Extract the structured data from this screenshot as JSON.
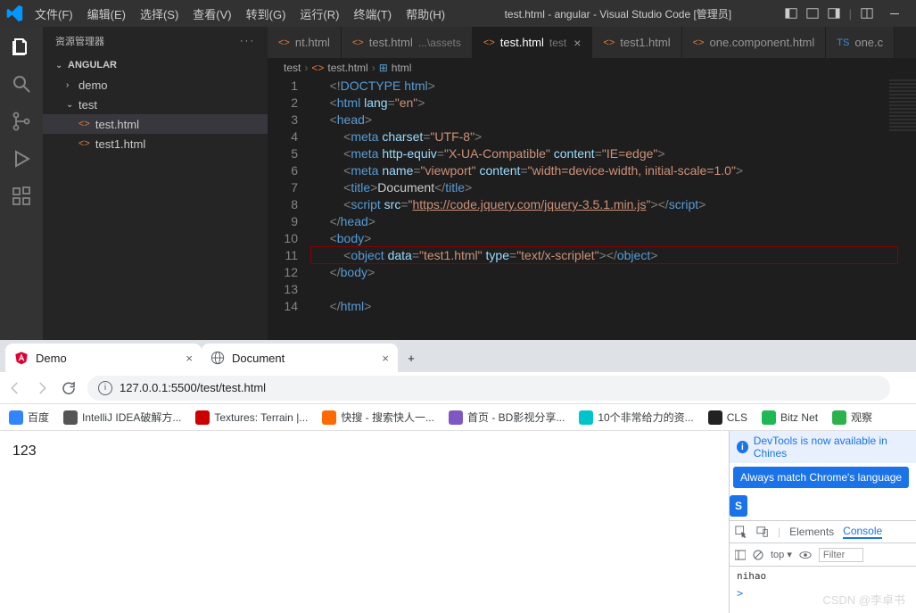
{
  "titlebar": {
    "menus": [
      "文件(F)",
      "编辑(E)",
      "选择(S)",
      "查看(V)",
      "转到(G)",
      "运行(R)",
      "终端(T)",
      "帮助(H)"
    ],
    "title": "test.html - angular - Visual Studio Code [管理员]"
  },
  "sidebar": {
    "title": "资源管理器",
    "root": "ANGULAR",
    "items": [
      {
        "label": "demo",
        "type": "folder",
        "expanded": false,
        "indent": 1
      },
      {
        "label": "test",
        "type": "folder",
        "expanded": true,
        "indent": 1
      },
      {
        "label": "test.html",
        "type": "file",
        "indent": 2,
        "active": true
      },
      {
        "label": "test1.html",
        "type": "file",
        "indent": 2
      }
    ]
  },
  "tabs": [
    {
      "label": "nt.html",
      "icon": "html",
      "partial": true
    },
    {
      "label": "test.html",
      "suffix": "...\\assets",
      "icon": "html"
    },
    {
      "label": "test.html",
      "suffix": "test",
      "icon": "html",
      "active": true,
      "close": true
    },
    {
      "label": "test1.html",
      "icon": "html"
    },
    {
      "label": "one.component.html",
      "icon": "html"
    },
    {
      "label": "one.c",
      "icon": "ts",
      "partial": true
    }
  ],
  "breadcrumbs": [
    "test",
    "test.html",
    "html"
  ],
  "code_lines": [
    {
      "n": 1,
      "segs": [
        [
          "    ",
          "p"
        ],
        [
          "<!",
          "punc"
        ],
        [
          "DOCTYPE html",
          "doc"
        ],
        [
          ">",
          "punc"
        ]
      ]
    },
    {
      "n": 2,
      "segs": [
        [
          "    ",
          "p"
        ],
        [
          "<",
          "punc"
        ],
        [
          "html ",
          "tag"
        ],
        [
          "lang",
          "attr"
        ],
        [
          "=",
          "punc"
        ],
        [
          "\"en\"",
          "str"
        ],
        [
          ">",
          "punc"
        ]
      ]
    },
    {
      "n": 3,
      "segs": [
        [
          "    ",
          "p"
        ],
        [
          "<",
          "punc"
        ],
        [
          "head",
          "tag"
        ],
        [
          ">",
          "punc"
        ]
      ]
    },
    {
      "n": 4,
      "segs": [
        [
          "        ",
          "p"
        ],
        [
          "<",
          "punc"
        ],
        [
          "meta ",
          "tag"
        ],
        [
          "charset",
          "attr"
        ],
        [
          "=",
          "punc"
        ],
        [
          "\"UTF-8\"",
          "str"
        ],
        [
          ">",
          "punc"
        ]
      ]
    },
    {
      "n": 5,
      "segs": [
        [
          "        ",
          "p"
        ],
        [
          "<",
          "punc"
        ],
        [
          "meta ",
          "tag"
        ],
        [
          "http-equiv",
          "attr"
        ],
        [
          "=",
          "punc"
        ],
        [
          "\"X-UA-Compatible\"",
          "str"
        ],
        [
          " ",
          "p"
        ],
        [
          "content",
          "attr"
        ],
        [
          "=",
          "punc"
        ],
        [
          "\"IE=edge\"",
          "str"
        ],
        [
          ">",
          "punc"
        ]
      ]
    },
    {
      "n": 6,
      "segs": [
        [
          "        ",
          "p"
        ],
        [
          "<",
          "punc"
        ],
        [
          "meta ",
          "tag"
        ],
        [
          "name",
          "attr"
        ],
        [
          "=",
          "punc"
        ],
        [
          "\"viewport\"",
          "str"
        ],
        [
          " ",
          "p"
        ],
        [
          "content",
          "attr"
        ],
        [
          "=",
          "punc"
        ],
        [
          "\"width=device-width, initial-scale=1.0\"",
          "str"
        ],
        [
          ">",
          "punc"
        ]
      ]
    },
    {
      "n": 7,
      "segs": [
        [
          "        ",
          "p"
        ],
        [
          "<",
          "punc"
        ],
        [
          "title",
          "tag"
        ],
        [
          ">",
          "punc"
        ],
        [
          "Document",
          "p"
        ],
        [
          "</",
          "punc"
        ],
        [
          "title",
          "tag"
        ],
        [
          ">",
          "punc"
        ]
      ]
    },
    {
      "n": 8,
      "segs": [
        [
          "        ",
          "p"
        ],
        [
          "<",
          "punc"
        ],
        [
          "script ",
          "tag"
        ],
        [
          "src",
          "attr"
        ],
        [
          "=",
          "punc"
        ],
        [
          "\"",
          "str"
        ],
        [
          "https://code.jquery.com/jquery-3.5.1.min.js",
          "url"
        ],
        [
          "\"",
          "str"
        ],
        [
          "></",
          "punc"
        ],
        [
          "script",
          "tag"
        ],
        [
          ">",
          "punc"
        ]
      ]
    },
    {
      "n": 9,
      "segs": [
        [
          "    ",
          "p"
        ],
        [
          "</",
          "punc"
        ],
        [
          "head",
          "tag"
        ],
        [
          ">",
          "punc"
        ]
      ]
    },
    {
      "n": 10,
      "segs": [
        [
          "    ",
          "p"
        ],
        [
          "<",
          "punc"
        ],
        [
          "body",
          "tag"
        ],
        [
          ">",
          "punc"
        ]
      ]
    },
    {
      "n": 11,
      "segs": [
        [
          "        ",
          "p"
        ],
        [
          "<",
          "punc"
        ],
        [
          "object ",
          "tag"
        ],
        [
          "data",
          "attr"
        ],
        [
          "=",
          "punc"
        ],
        [
          "\"test1.html\"",
          "str"
        ],
        [
          " ",
          "p"
        ],
        [
          "type",
          "attr"
        ],
        [
          "=",
          "punc"
        ],
        [
          "\"text/x-scriplet\"",
          "str"
        ],
        [
          "></",
          "punc"
        ],
        [
          "object",
          "tag"
        ],
        [
          ">",
          "punc"
        ]
      ],
      "hl": true
    },
    {
      "n": 12,
      "segs": [
        [
          "    ",
          "p"
        ],
        [
          "</",
          "punc"
        ],
        [
          "body",
          "tag"
        ],
        [
          ">",
          "punc"
        ]
      ]
    },
    {
      "n": 13,
      "segs": [
        [
          "    ",
          "p"
        ]
      ]
    },
    {
      "n": 14,
      "segs": [
        [
          "    ",
          "p"
        ],
        [
          "</",
          "punc"
        ],
        [
          "html",
          "tag"
        ],
        [
          ">",
          "punc"
        ]
      ]
    }
  ],
  "chrome": {
    "tabs": [
      {
        "title": "Demo",
        "icon": "angular"
      },
      {
        "title": "Document",
        "icon": "page"
      }
    ],
    "url": "127.0.0.1:5500/test/test.html",
    "bookmarks": [
      {
        "label": "百度",
        "color": "#3385ff"
      },
      {
        "label": "IntelliJ IDEA破解方...",
        "color": "#555"
      },
      {
        "label": "Textures: Terrain |...",
        "color": "#cc0000"
      },
      {
        "label": "快搜 - 搜索快人一...",
        "color": "#ff6a00"
      },
      {
        "label": "首页 - BD影视分享...",
        "color": "#7e57c2"
      },
      {
        "label": "10个非常给力的资...",
        "color": "#00c4cc"
      },
      {
        "label": "CLS",
        "color": "#222"
      },
      {
        "label": "Bitz Net",
        "color": "#1db954"
      },
      {
        "label": "观察",
        "color": "#2bb24c"
      }
    ],
    "page_text": "123",
    "devtools": {
      "banner": "DevTools is now available in Chines",
      "button": "Always match Chrome's language",
      "button2": "S",
      "tabs": [
        "Elements",
        "Console"
      ],
      "active_tab": "Console",
      "context": "top",
      "filter_placeholder": "Filter",
      "log": "nihao",
      "prompt": ">"
    }
  },
  "watermark": "CSDN @李卓书"
}
